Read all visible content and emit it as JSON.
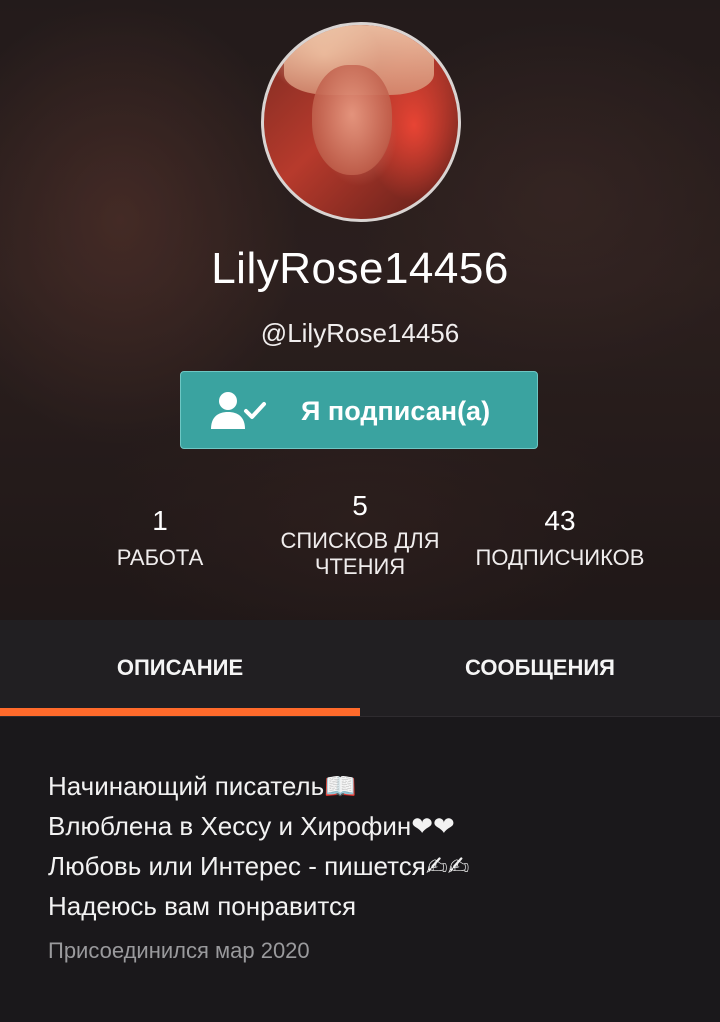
{
  "profile": {
    "username": "LilyRose14456",
    "handle": "@LilyRose14456",
    "follow_button_label": "Я подписан(а)",
    "accent_color": "#3aa3a0",
    "tab_indicator_color": "#ff6a2b"
  },
  "stats": {
    "works": {
      "value": "1",
      "label": "РАБОТА"
    },
    "reading_lists": {
      "value": "5",
      "label_line1": "СПИСКОВ ДЛЯ",
      "label_line2": "ЧТЕНИЯ"
    },
    "followers": {
      "value": "43",
      "label": "ПОДПИСЧИКОВ"
    }
  },
  "tabs": [
    {
      "label": "ОПИСАНИЕ",
      "active": true
    },
    {
      "label": "СООБЩЕНИЯ",
      "active": false
    }
  ],
  "about": {
    "bio_lines": [
      "Начинающий писатель📖",
      "Влюблена в Хессу и Хирофин❤❤",
      "Любовь или Интерес - пишется✍✍",
      "Надеюсь вам понравится"
    ],
    "joined": "Присоединился мар 2020"
  },
  "icons": {
    "follow_button_icon": "user-check-icon",
    "avatar": "profile-photo"
  }
}
